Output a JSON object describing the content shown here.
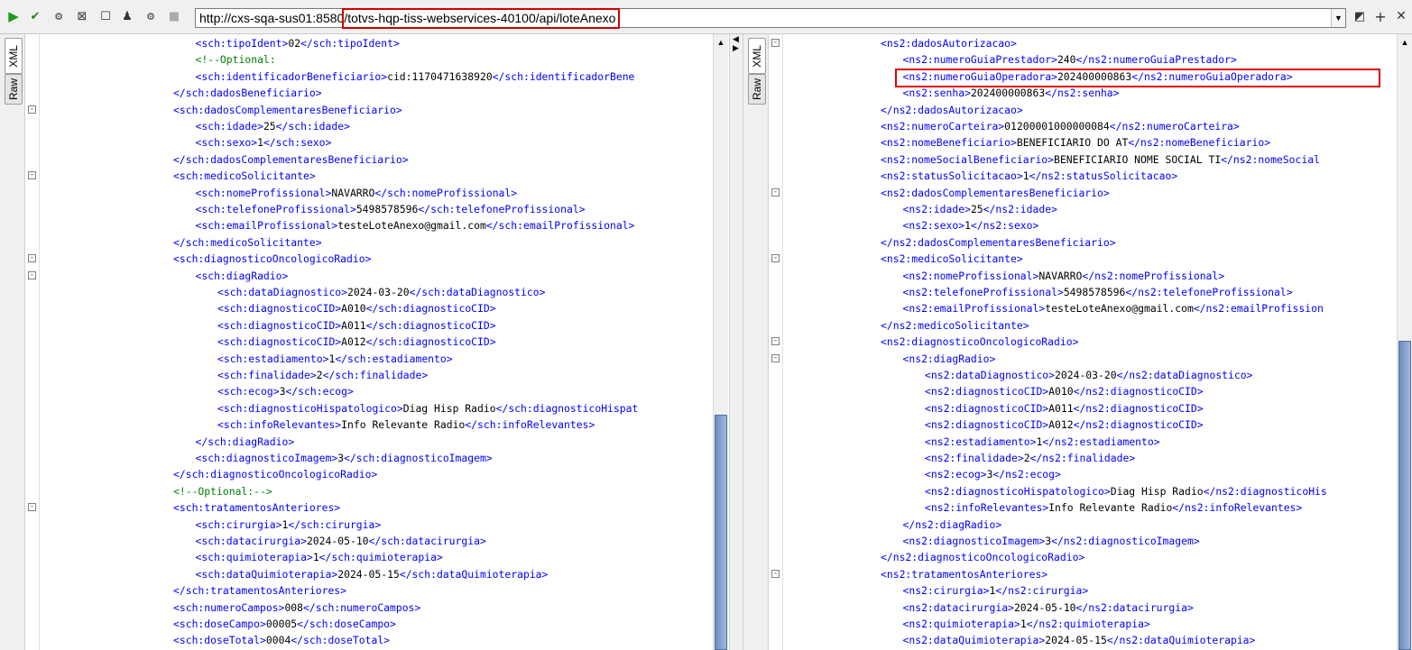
{
  "toolbar": {
    "url": "http://cxs-sqa-sus01:8580/totvs-hqp-tiss-webservices-40100/api/loteAnexo",
    "icons": [
      "play-icon",
      "validate-icon",
      "settings-icon",
      "expand-icon",
      "stop-icon",
      "user-icon",
      "disabled-icon",
      "chevron-down-icon",
      "format-icon",
      "plus-icon",
      "close-icon"
    ]
  },
  "tabs": {
    "xml": "XML",
    "raw": "Raw"
  },
  "left_lines": [
    {
      "i": 7,
      "f": "",
      "t": [
        [
          "b",
          "<sch:tipoIdent>"
        ],
        [
          "t",
          "02"
        ],
        [
          "b",
          "</sch:tipoIdent>"
        ]
      ]
    },
    {
      "i": 7,
      "f": "",
      "t": [
        [
          "c",
          "<!--Optional:"
        ]
      ]
    },
    {
      "i": 7,
      "f": "",
      "t": [
        [
          "b",
          "<sch:identificadorBeneficiario>"
        ],
        [
          "t",
          "cid:1170471638920"
        ],
        [
          "b",
          "</sch:identificadorBene"
        ]
      ]
    },
    {
      "i": 6,
      "f": "",
      "t": [
        [
          "b",
          "</sch:dadosBeneficiario>"
        ]
      ]
    },
    {
      "i": 6,
      "f": "-",
      "t": [
        [
          "b",
          "<sch:dadosComplementaresBeneficiario>"
        ]
      ]
    },
    {
      "i": 7,
      "f": "",
      "t": [
        [
          "b",
          "<sch:idade>"
        ],
        [
          "t",
          "25"
        ],
        [
          "b",
          "</sch:idade>"
        ]
      ]
    },
    {
      "i": 7,
      "f": "",
      "t": [
        [
          "b",
          "<sch:sexo>"
        ],
        [
          "t",
          "1"
        ],
        [
          "b",
          "</sch:sexo>"
        ]
      ]
    },
    {
      "i": 6,
      "f": "",
      "t": [
        [
          "b",
          "</sch:dadosComplementaresBeneficiario>"
        ]
      ]
    },
    {
      "i": 6,
      "f": "-",
      "t": [
        [
          "b",
          "<sch:medicoSolicitante>"
        ]
      ]
    },
    {
      "i": 7,
      "f": "",
      "t": [
        [
          "b",
          "<sch:nomeProfissional>"
        ],
        [
          "t",
          "NAVARRO"
        ],
        [
          "b",
          "</sch:nomeProfissional>"
        ]
      ]
    },
    {
      "i": 7,
      "f": "",
      "t": [
        [
          "b",
          "<sch:telefoneProfissional>"
        ],
        [
          "t",
          "5498578596"
        ],
        [
          "b",
          "</sch:telefoneProfissional>"
        ]
      ]
    },
    {
      "i": 7,
      "f": "",
      "t": [
        [
          "b",
          "<sch:emailProfissional>"
        ],
        [
          "t",
          "testeLoteAnexo@gmail.com"
        ],
        [
          "b",
          "</sch:emailProfissional>"
        ]
      ]
    },
    {
      "i": 6,
      "f": "",
      "t": [
        [
          "b",
          "</sch:medicoSolicitante>"
        ]
      ]
    },
    {
      "i": 6,
      "f": "-",
      "t": [
        [
          "b",
          "<sch:diagnosticoOncologicoRadio>"
        ]
      ]
    },
    {
      "i": 7,
      "f": "-",
      "t": [
        [
          "b",
          "<sch:diagRadio>"
        ]
      ]
    },
    {
      "i": 8,
      "f": "",
      "t": [
        [
          "b",
          "<sch:dataDiagnostico>"
        ],
        [
          "t",
          "2024-03-20"
        ],
        [
          "b",
          "</sch:dataDiagnostico>"
        ]
      ]
    },
    {
      "i": 8,
      "f": "",
      "t": [
        [
          "b",
          "<sch:diagnosticoCID>"
        ],
        [
          "t",
          "A010"
        ],
        [
          "b",
          "</sch:diagnosticoCID>"
        ]
      ]
    },
    {
      "i": 8,
      "f": "",
      "t": [
        [
          "b",
          "<sch:diagnosticoCID>"
        ],
        [
          "t",
          "A011"
        ],
        [
          "b",
          "</sch:diagnosticoCID>"
        ]
      ]
    },
    {
      "i": 8,
      "f": "",
      "t": [
        [
          "b",
          "<sch:diagnosticoCID>"
        ],
        [
          "t",
          "A012"
        ],
        [
          "b",
          "</sch:diagnosticoCID>"
        ]
      ]
    },
    {
      "i": 8,
      "f": "",
      "t": [
        [
          "b",
          "<sch:estadiamento>"
        ],
        [
          "t",
          "1"
        ],
        [
          "b",
          "</sch:estadiamento>"
        ]
      ]
    },
    {
      "i": 8,
      "f": "",
      "t": [
        [
          "b",
          "<sch:finalidade>"
        ],
        [
          "t",
          "2"
        ],
        [
          "b",
          "</sch:finalidade>"
        ]
      ]
    },
    {
      "i": 8,
      "f": "",
      "t": [
        [
          "b",
          "<sch:ecog>"
        ],
        [
          "t",
          "3"
        ],
        [
          "b",
          "</sch:ecog>"
        ]
      ]
    },
    {
      "i": 8,
      "f": "",
      "t": [
        [
          "b",
          "<sch:diagnosticoHispatologico>"
        ],
        [
          "t",
          "Diag Hisp Radio"
        ],
        [
          "b",
          "</sch:diagnosticoHispat"
        ]
      ]
    },
    {
      "i": 8,
      "f": "",
      "t": [
        [
          "b",
          "<sch:infoRelevantes>"
        ],
        [
          "t",
          "Info Relevante Radio"
        ],
        [
          "b",
          "</sch:infoRelevantes>"
        ]
      ]
    },
    {
      "i": 7,
      "f": "",
      "t": [
        [
          "b",
          "</sch:diagRadio>"
        ]
      ]
    },
    {
      "i": 7,
      "f": "",
      "t": [
        [
          "b",
          "<sch:diagnosticoImagem>"
        ],
        [
          "t",
          "3"
        ],
        [
          "b",
          "</sch:diagnosticoImagem>"
        ]
      ]
    },
    {
      "i": 6,
      "f": "",
      "t": [
        [
          "b",
          "</sch:diagnosticoOncologicoRadio>"
        ]
      ]
    },
    {
      "i": 6,
      "f": "",
      "t": [
        [
          "c",
          "<!--Optional:-->"
        ]
      ]
    },
    {
      "i": 6,
      "f": "-",
      "t": [
        [
          "b",
          "<sch:tratamentosAnteriores>"
        ]
      ]
    },
    {
      "i": 7,
      "f": "",
      "t": [
        [
          "b",
          "<sch:cirurgia>"
        ],
        [
          "t",
          "1"
        ],
        [
          "b",
          "</sch:cirurgia>"
        ]
      ]
    },
    {
      "i": 7,
      "f": "",
      "t": [
        [
          "b",
          "<sch:datacirurgia>"
        ],
        [
          "t",
          "2024-05-10"
        ],
        [
          "b",
          "</sch:datacirurgia>"
        ]
      ]
    },
    {
      "i": 7,
      "f": "",
      "t": [
        [
          "b",
          "<sch:quimioterapia>"
        ],
        [
          "t",
          "1"
        ],
        [
          "b",
          "</sch:quimioterapia>"
        ]
      ]
    },
    {
      "i": 7,
      "f": "",
      "t": [
        [
          "b",
          "<sch:dataQuimioterapia>"
        ],
        [
          "t",
          "2024-05-15"
        ],
        [
          "b",
          "</sch:dataQuimioterapia>"
        ]
      ]
    },
    {
      "i": 6,
      "f": "",
      "t": [
        [
          "b",
          "</sch:tratamentosAnteriores>"
        ]
      ]
    },
    {
      "i": 6,
      "f": "",
      "t": [
        [
          "b",
          "<sch:numeroCampos>"
        ],
        [
          "t",
          "008"
        ],
        [
          "b",
          "</sch:numeroCampos>"
        ]
      ]
    },
    {
      "i": 6,
      "f": "",
      "t": [
        [
          "b",
          "<sch:doseCampo>"
        ],
        [
          "t",
          "00005"
        ],
        [
          "b",
          "</sch:doseCampo>"
        ]
      ]
    },
    {
      "i": 6,
      "f": "",
      "t": [
        [
          "b",
          "<sch:doseTotal>"
        ],
        [
          "t",
          "0004"
        ],
        [
          "b",
          "</sch:doseTotal>"
        ]
      ]
    }
  ],
  "right_lines": [
    {
      "i": 4,
      "f": "-",
      "t": [
        [
          "b",
          "<ns2:dadosAutorizacao>"
        ]
      ]
    },
    {
      "i": 5,
      "f": "",
      "t": [
        [
          "b",
          "<ns2:numeroGuiaPrestador>"
        ],
        [
          "t",
          "240"
        ],
        [
          "b",
          "</ns2:numeroGuiaPrestador>"
        ]
      ]
    },
    {
      "i": 5,
      "f": "",
      "t": [
        [
          "b",
          "<ns2:numeroGuiaOperadora>"
        ],
        [
          "t",
          "202400000863"
        ],
        [
          "b",
          "</ns2:numeroGuiaOperadora>"
        ]
      ]
    },
    {
      "i": 5,
      "f": "",
      "t": [
        [
          "b",
          "<ns2:senha>"
        ],
        [
          "t",
          "202400000863"
        ],
        [
          "b",
          "</ns2:senha>"
        ]
      ]
    },
    {
      "i": 4,
      "f": "",
      "t": [
        [
          "b",
          "</ns2:dadosAutorizacao>"
        ]
      ]
    },
    {
      "i": 4,
      "f": "",
      "t": [
        [
          "b",
          "<ns2:numeroCarteira>"
        ],
        [
          "t",
          "01200001000000084"
        ],
        [
          "b",
          "</ns2:numeroCarteira>"
        ]
      ]
    },
    {
      "i": 4,
      "f": "",
      "t": [
        [
          "b",
          "<ns2:nomeBeneficiario>"
        ],
        [
          "t",
          "BENEFICIARIO DO AT"
        ],
        [
          "b",
          "</ns2:nomeBeneficiario>"
        ]
      ]
    },
    {
      "i": 4,
      "f": "",
      "t": [
        [
          "b",
          "<ns2:nomeSocialBeneficiario>"
        ],
        [
          "t",
          "BENEFICIARIO NOME SOCIAL TI"
        ],
        [
          "b",
          "</ns2:nomeSocial"
        ]
      ]
    },
    {
      "i": 4,
      "f": "",
      "t": [
        [
          "b",
          "<ns2:statusSolicitacao>"
        ],
        [
          "t",
          "1"
        ],
        [
          "b",
          "</ns2:statusSolicitacao>"
        ]
      ]
    },
    {
      "i": 4,
      "f": "-",
      "t": [
        [
          "b",
          "<ns2:dadosComplementaresBeneficiario>"
        ]
      ]
    },
    {
      "i": 5,
      "f": "",
      "t": [
        [
          "b",
          "<ns2:idade>"
        ],
        [
          "t",
          "25"
        ],
        [
          "b",
          "</ns2:idade>"
        ]
      ]
    },
    {
      "i": 5,
      "f": "",
      "t": [
        [
          "b",
          "<ns2:sexo>"
        ],
        [
          "t",
          "1"
        ],
        [
          "b",
          "</ns2:sexo>"
        ]
      ]
    },
    {
      "i": 4,
      "f": "",
      "t": [
        [
          "b",
          "</ns2:dadosComplementaresBeneficiario>"
        ]
      ]
    },
    {
      "i": 4,
      "f": "-",
      "t": [
        [
          "b",
          "<ns2:medicoSolicitante>"
        ]
      ]
    },
    {
      "i": 5,
      "f": "",
      "t": [
        [
          "b",
          "<ns2:nomeProfissional>"
        ],
        [
          "t",
          "NAVARRO"
        ],
        [
          "b",
          "</ns2:nomeProfissional>"
        ]
      ]
    },
    {
      "i": 5,
      "f": "",
      "t": [
        [
          "b",
          "<ns2:telefoneProfissional>"
        ],
        [
          "t",
          "5498578596"
        ],
        [
          "b",
          "</ns2:telefoneProfissional>"
        ]
      ]
    },
    {
      "i": 5,
      "f": "",
      "t": [
        [
          "b",
          "<ns2:emailProfissional>"
        ],
        [
          "t",
          "testeLoteAnexo@gmail.com"
        ],
        [
          "b",
          "</ns2:emailProfission"
        ]
      ]
    },
    {
      "i": 4,
      "f": "",
      "t": [
        [
          "b",
          "</ns2:medicoSolicitante>"
        ]
      ]
    },
    {
      "i": 4,
      "f": "-",
      "t": [
        [
          "b",
          "<ns2:diagnosticoOncologicoRadio>"
        ]
      ]
    },
    {
      "i": 5,
      "f": "-",
      "t": [
        [
          "b",
          "<ns2:diagRadio>"
        ]
      ]
    },
    {
      "i": 6,
      "f": "",
      "t": [
        [
          "b",
          "<ns2:dataDiagnostico>"
        ],
        [
          "t",
          "2024-03-20"
        ],
        [
          "b",
          "</ns2:dataDiagnostico>"
        ]
      ]
    },
    {
      "i": 6,
      "f": "",
      "t": [
        [
          "b",
          "<ns2:diagnosticoCID>"
        ],
        [
          "t",
          "A010"
        ],
        [
          "b",
          "</ns2:diagnosticoCID>"
        ]
      ]
    },
    {
      "i": 6,
      "f": "",
      "t": [
        [
          "b",
          "<ns2:diagnosticoCID>"
        ],
        [
          "t",
          "A011"
        ],
        [
          "b",
          "</ns2:diagnosticoCID>"
        ]
      ]
    },
    {
      "i": 6,
      "f": "",
      "t": [
        [
          "b",
          "<ns2:diagnosticoCID>"
        ],
        [
          "t",
          "A012"
        ],
        [
          "b",
          "</ns2:diagnosticoCID>"
        ]
      ]
    },
    {
      "i": 6,
      "f": "",
      "t": [
        [
          "b",
          "<ns2:estadiamento>"
        ],
        [
          "t",
          "1"
        ],
        [
          "b",
          "</ns2:estadiamento>"
        ]
      ]
    },
    {
      "i": 6,
      "f": "",
      "t": [
        [
          "b",
          "<ns2:finalidade>"
        ],
        [
          "t",
          "2"
        ],
        [
          "b",
          "</ns2:finalidade>"
        ]
      ]
    },
    {
      "i": 6,
      "f": "",
      "t": [
        [
          "b",
          "<ns2:ecog>"
        ],
        [
          "t",
          "3"
        ],
        [
          "b",
          "</ns2:ecog>"
        ]
      ]
    },
    {
      "i": 6,
      "f": "",
      "t": [
        [
          "b",
          "<ns2:diagnosticoHispatologico>"
        ],
        [
          "t",
          "Diag Hisp Radio"
        ],
        [
          "b",
          "</ns2:diagnosticoHis"
        ]
      ]
    },
    {
      "i": 6,
      "f": "",
      "t": [
        [
          "b",
          "<ns2:infoRelevantes>"
        ],
        [
          "t",
          "Info Relevante Radio"
        ],
        [
          "b",
          "</ns2:infoRelevantes>"
        ]
      ]
    },
    {
      "i": 5,
      "f": "",
      "t": [
        [
          "b",
          "</ns2:diagRadio>"
        ]
      ]
    },
    {
      "i": 5,
      "f": "",
      "t": [
        [
          "b",
          "<ns2:diagnosticoImagem>"
        ],
        [
          "t",
          "3"
        ],
        [
          "b",
          "</ns2:diagnosticoImagem>"
        ]
      ]
    },
    {
      "i": 4,
      "f": "",
      "t": [
        [
          "b",
          "</ns2:diagnosticoOncologicoRadio>"
        ]
      ]
    },
    {
      "i": 4,
      "f": "-",
      "t": [
        [
          "b",
          "<ns2:tratamentosAnteriores>"
        ]
      ]
    },
    {
      "i": 5,
      "f": "",
      "t": [
        [
          "b",
          "<ns2:cirurgia>"
        ],
        [
          "t",
          "1"
        ],
        [
          "b",
          "</ns2:cirurgia>"
        ]
      ]
    },
    {
      "i": 5,
      "f": "",
      "t": [
        [
          "b",
          "<ns2:datacirurgia>"
        ],
        [
          "t",
          "2024-05-10"
        ],
        [
          "b",
          "</ns2:datacirurgia>"
        ]
      ]
    },
    {
      "i": 5,
      "f": "",
      "t": [
        [
          "b",
          "<ns2:quimioterapia>"
        ],
        [
          "t",
          "1"
        ],
        [
          "b",
          "</ns2:quimioterapia>"
        ]
      ]
    },
    {
      "i": 5,
      "f": "",
      "t": [
        [
          "b",
          "<ns2:dataQuimioterapia>"
        ],
        [
          "t",
          "2024-05-15"
        ],
        [
          "b",
          "</ns2:dataQuimioterapia>"
        ]
      ]
    }
  ],
  "colors": {
    "tag": "#0000ff",
    "text": "#000000",
    "comment": "#008000",
    "highlight": "#e00000"
  }
}
